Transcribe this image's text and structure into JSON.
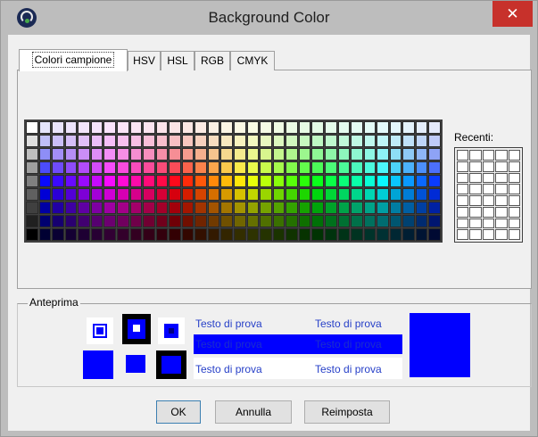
{
  "window": {
    "title": "Background Color",
    "close_label": "✕"
  },
  "tabs": [
    {
      "label": "Colori campione",
      "active": true
    },
    {
      "label": "HSV"
    },
    {
      "label": "HSL"
    },
    {
      "label": "RGB"
    },
    {
      "label": "CMYK"
    }
  ],
  "recent": {
    "label": "Recenti:",
    "cols": 5,
    "rows": 8
  },
  "preview": {
    "label": "Anteprima",
    "sample_texts": [
      "Testo di prova",
      "Testo di prova",
      "Testo di prova",
      "Testo di prova",
      "Testo di prova",
      "Testo di prova"
    ],
    "selected_color": "#0000ff"
  },
  "buttons": {
    "ok": "OK",
    "cancel": "Annulla",
    "reset": "Reimposta"
  },
  "colors": {
    "accent": "#0000ff",
    "close": "#c7312b",
    "preview_text": "#2740c8"
  }
}
